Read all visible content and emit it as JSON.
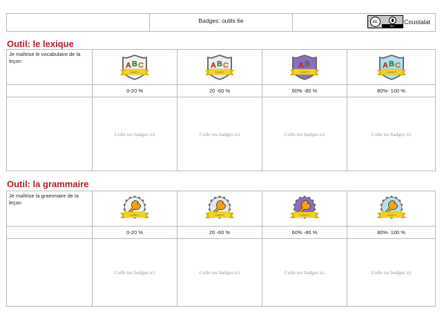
{
  "header": {
    "title": "Badges: outils 6e",
    "license_cc": "cc",
    "license_by": "BY",
    "author": "Coustalat"
  },
  "sections": [
    {
      "title": "Outil: le lexique",
      "description": "Je maîtrise le vocabulaire de la leçon",
      "badges": [
        {
          "letters": [
            "A",
            "B",
            "C"
          ],
          "level": "Level 1",
          "fill": "#f2f2f2",
          "icon": "abc-shield-icon"
        },
        {
          "letters": [
            "A",
            "B",
            "C"
          ],
          "level": "Level 2",
          "fill": "#eeeeee",
          "icon": "abc-shield-icon"
        },
        {
          "letters": [
            "A",
            "B"
          ],
          "level": "Level 3",
          "fill": "#8f6bc4",
          "icon": "abc-shield-icon"
        },
        {
          "letters": [
            "A",
            "B",
            "C"
          ],
          "level": "Level 4",
          "fill": "#b3dff3",
          "icon": "abc-shield-icon"
        }
      ],
      "ranges": [
        "0-20 %",
        "20 -60 %",
        "60% -80 %",
        "80%- 100 %"
      ],
      "paste_label": "Colle tes badges ici"
    },
    {
      "title": "Outil: la grammaire",
      "description": "Je maîtrise la grammaire de la leçon",
      "badges": [
        {
          "level": "Level 1",
          "fill": "#f2f2f2",
          "icon": "wrench-seal-icon"
        },
        {
          "level": "Level 2",
          "fill": "#e6e6ee",
          "icon": "wrench-seal-icon"
        },
        {
          "level": "Level 3",
          "fill": "#8f6bc4",
          "icon": "wrench-seal-icon"
        },
        {
          "level": "Level 4",
          "fill": "#b3dff3",
          "icon": "wrench-seal-icon"
        }
      ],
      "ranges": [
        "0-20 %",
        "20 -60 %",
        "60% -80 %",
        "80%- 100 %"
      ],
      "paste_label": "Colle tes badges ici"
    }
  ],
  "colors": {
    "section_title": "#c5151e",
    "ribbon": "#f2d321",
    "letter_a": "#e4312b",
    "letter_b": "#3aa635",
    "letter_c": "#f29a1f",
    "wrench": "#f2a30f"
  }
}
